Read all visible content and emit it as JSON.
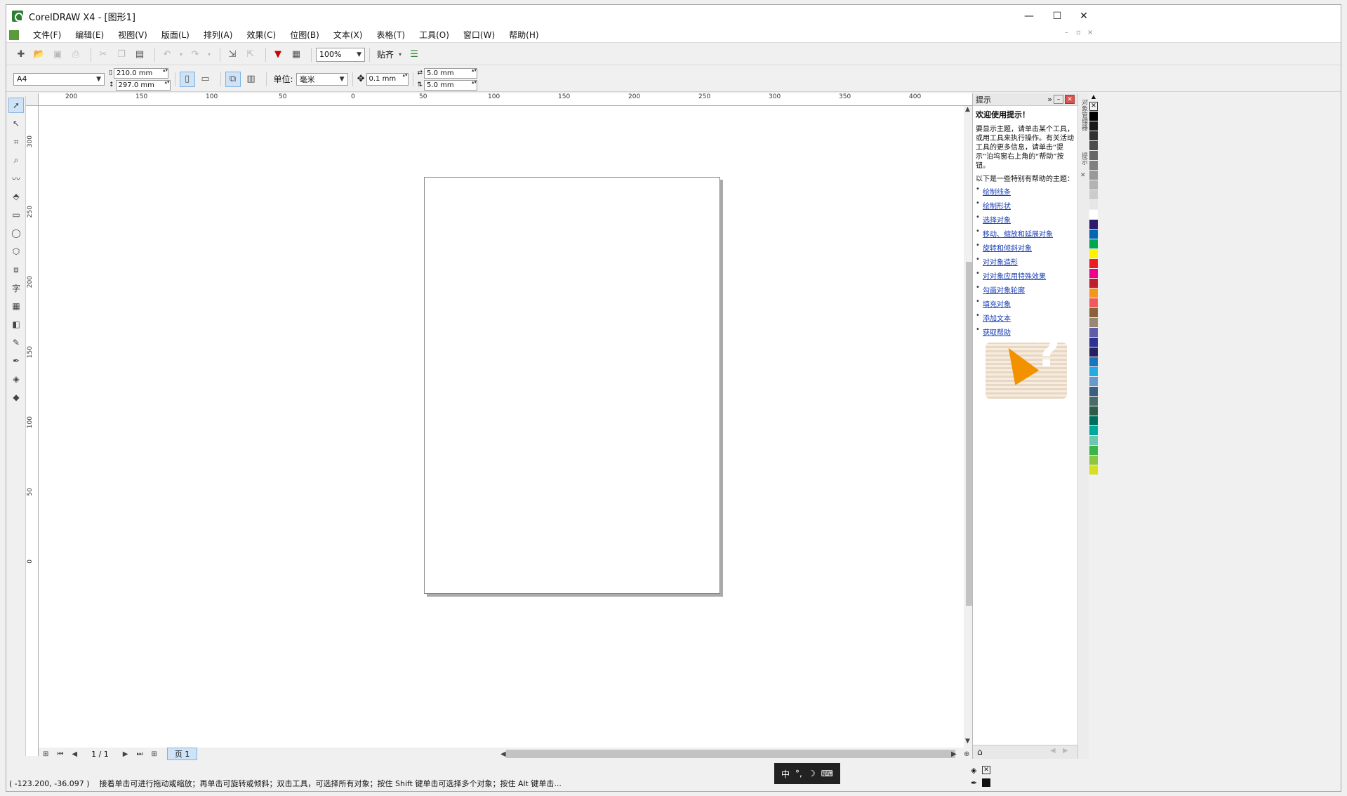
{
  "window": {
    "title": "CorelDRAW X4 - [图形1]",
    "minimize": "—",
    "maximize": "☐",
    "close": "✕"
  },
  "menu": [
    "文件(F)",
    "编辑(E)",
    "视图(V)",
    "版面(L)",
    "排列(A)",
    "效果(C)",
    "位图(B)",
    "文本(X)",
    "表格(T)",
    "工具(O)",
    "窗口(W)",
    "帮助(H)"
  ],
  "toolbar": {
    "zoom": "100%",
    "snap_label": "贴齐"
  },
  "propertybar": {
    "paper_size": "A4",
    "width": "210.0 mm",
    "height": "297.0 mm",
    "units_label": "单位:",
    "units_value": "毫米",
    "nudge": "0.1 mm",
    "dup_x": "5.0 mm",
    "dup_y": "5.0 mm"
  },
  "ruler": {
    "h_marks": [
      "200",
      "150",
      "100",
      "50",
      "0",
      "50",
      "100",
      "150",
      "200",
      "250",
      "300",
      "350",
      "400"
    ],
    "v_marks": [
      "300",
      "250",
      "200",
      "150",
      "100",
      "50",
      "0"
    ]
  },
  "pagenav": {
    "counter": "1 / 1",
    "tab": "页 1"
  },
  "statusbar": {
    "coords": "( -123.200, -36.097 )",
    "hint": "接着单击可进行拖动或缩放；再单击可旋转或倾斜；双击工具，可选择所有对象；按住 Shift 键单击可选择多个对象；按住 Alt 键单击..."
  },
  "ime": {
    "lang": "中",
    "dot": "°,",
    "moon": "☽",
    "kbd": "⌨"
  },
  "docker": {
    "title": "提示",
    "welcome": "欢迎使用提示！",
    "intro": "要显示主题，请单击某个工具，或用工具来执行操作。有关活动工具的更多信息，请单击“提示”泊坞窗右上角的“帮助”按钮。",
    "topics_intro": "以下是一些特别有帮助的主题：",
    "topics": [
      "绘制线条",
      "绘制形状",
      "选择对象",
      "移动、缩放和延展对象",
      "旋转和倾斜对象",
      "对对象造形",
      "对对象应用特殊效果",
      "勾画对象轮廓",
      "填充对象",
      "添加文本",
      "获取帮助"
    ],
    "tab_objects": "对象管理器",
    "tab_hints": "提示"
  },
  "palette_colors": [
    "#000000",
    "#1a1a1a",
    "#333333",
    "#4d4d4d",
    "#666666",
    "#808080",
    "#999999",
    "#b3b3b3",
    "#cccccc",
    "#e6e6e6",
    "#ffffff",
    "#2d1b6b",
    "#0067b3",
    "#00a651",
    "#fff200",
    "#ed1c24",
    "#ec008c",
    "#be1e2d",
    "#f7941d",
    "#f15a5a",
    "#8c6239",
    "#998675",
    "#605ca8",
    "#2e3192",
    "#262262",
    "#1b75bc",
    "#27aae1",
    "#6699cc",
    "#3a5f7f",
    "#4b6b6b",
    "#2f5c4a",
    "#006e5f",
    "#00a79d",
    "#6dc5b2",
    "#39b54a",
    "#8dc63f",
    "#d7df23"
  ]
}
